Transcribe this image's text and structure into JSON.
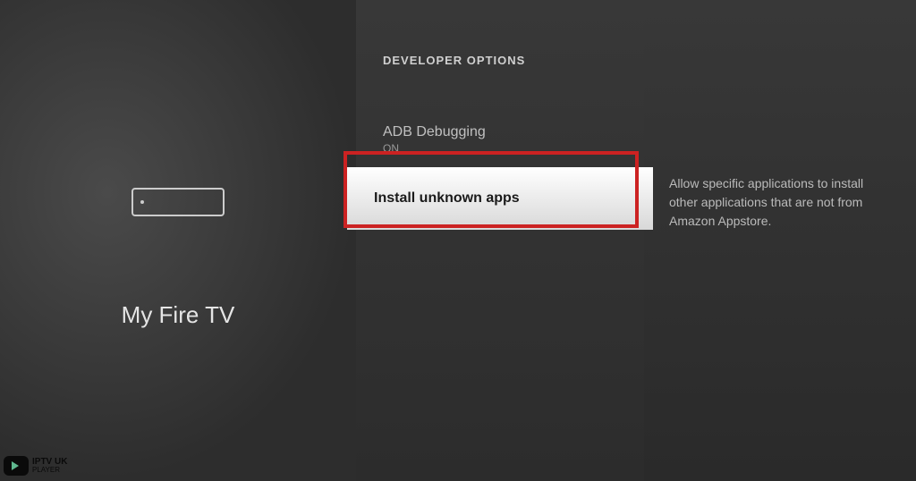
{
  "left": {
    "device_name": "My Fire TV"
  },
  "middle": {
    "section_title": "DEVELOPER OPTIONS",
    "items": [
      {
        "label": "ADB Debugging",
        "status": "ON"
      },
      {
        "label": "Install unknown apps"
      }
    ]
  },
  "right": {
    "description": "Allow specific applications to install other applications that are not from Amazon Appstore."
  },
  "watermark": {
    "line1": "IPTV UK",
    "line2": "PLAYER"
  }
}
